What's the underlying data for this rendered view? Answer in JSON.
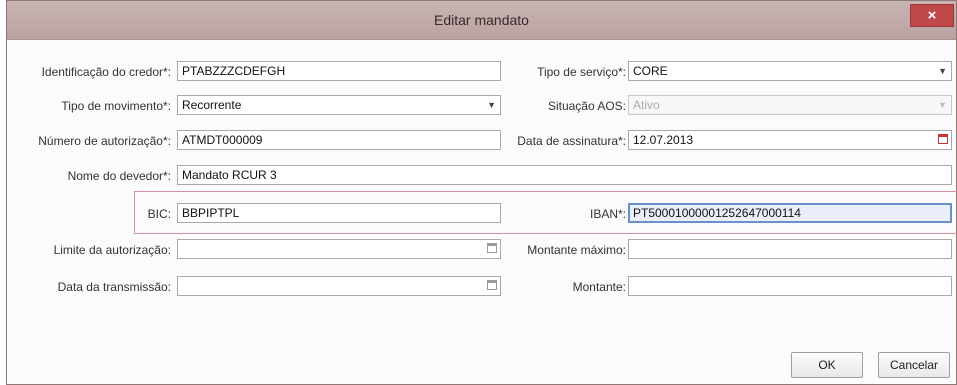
{
  "dialog": {
    "title": "Editar mandato",
    "close_label": "×"
  },
  "fields": {
    "creditor_id": {
      "label": "Identificação do credor*:",
      "value": "PTABZZZCDEFGH"
    },
    "service_type": {
      "label": "Tipo de serviço*:",
      "value": "CORE"
    },
    "movement_type": {
      "label": "Tipo de movimento*:",
      "value": "Recorrente"
    },
    "aos_status": {
      "label": "Situação AOS:",
      "value": "Ativo"
    },
    "auth_number": {
      "label": "Número de autorização*:",
      "value": "ATMDT000009"
    },
    "signature_date": {
      "label": "Data de assinatura*:",
      "value": "12.07.2013"
    },
    "debtor_name": {
      "label": "Nome do devedor*:",
      "value": "Mandato RCUR 3"
    },
    "bic": {
      "label": "BIC:",
      "value": "BBPIPTPL"
    },
    "iban": {
      "label": "IBAN*:",
      "value": "PT50001000001252647000114"
    },
    "auth_limit": {
      "label": "Limite da autorização:",
      "value": ""
    },
    "max_amount": {
      "label": "Montante máximo:",
      "value": ""
    },
    "transmission_date": {
      "label": "Data da transmissão:",
      "value": ""
    },
    "amount": {
      "label": "Montante:",
      "value": ""
    }
  },
  "buttons": {
    "ok": "OK",
    "cancel": "Cancelar"
  },
  "icons": {
    "dropdown": "chevron-down-icon",
    "calendar": "calendar-icon"
  }
}
